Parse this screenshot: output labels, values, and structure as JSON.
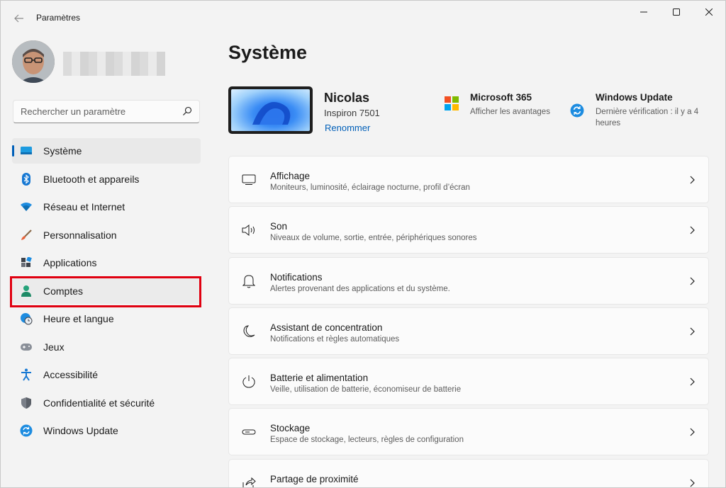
{
  "window": {
    "title": "Paramètres",
    "controls": {
      "minimize": "—",
      "maximize": "☐",
      "close": "✕"
    }
  },
  "sidebar": {
    "search": {
      "placeholder": "Rechercher un paramètre",
      "value": ""
    },
    "items": [
      {
        "label": "Système",
        "icon": "monitor-icon",
        "active": true
      },
      {
        "label": "Bluetooth et appareils",
        "icon": "bluetooth-icon"
      },
      {
        "label": "Réseau et Internet",
        "icon": "wifi-icon"
      },
      {
        "label": "Personnalisation",
        "icon": "paintbrush-icon"
      },
      {
        "label": "Applications",
        "icon": "apps-icon"
      },
      {
        "label": "Comptes",
        "icon": "person-icon",
        "highlighted": true
      },
      {
        "label": "Heure et langue",
        "icon": "globe-clock-icon"
      },
      {
        "label": "Jeux",
        "icon": "gamepad-icon"
      },
      {
        "label": "Accessibilité",
        "icon": "accessibility-icon"
      },
      {
        "label": "Confidentialité et sécurité",
        "icon": "shield-icon"
      },
      {
        "label": "Windows Update",
        "icon": "sync-icon"
      }
    ]
  },
  "main": {
    "page_title": "Système",
    "device": {
      "name": "Nicolas",
      "model": "Inspiron 7501",
      "rename_label": "Renommer"
    },
    "microsoft365": {
      "title": "Microsoft 365",
      "subtitle": "Afficher les avantages"
    },
    "windows_update": {
      "title": "Windows Update",
      "subtitle_line1": "Dernière vérification : il y a 4",
      "subtitle_line2": "heures"
    },
    "cards": [
      {
        "title": "Affichage",
        "description": "Moniteurs, luminosité, éclairage nocturne, profil d’écran",
        "icon": "display-icon"
      },
      {
        "title": "Son",
        "description": "Niveaux de volume, sortie, entrée, périphériques sonores",
        "icon": "speaker-icon"
      },
      {
        "title": "Notifications",
        "description": "Alertes provenant des applications et du système.",
        "icon": "bell-icon"
      },
      {
        "title": "Assistant de concentration",
        "description": "Notifications et règles automatiques",
        "icon": "moon-icon"
      },
      {
        "title": "Batterie et alimentation",
        "description": "Veille, utilisation de batterie, économiseur de batterie",
        "icon": "power-icon"
      },
      {
        "title": "Stockage",
        "description": "Espace de stockage, lecteurs, règles de configuration",
        "icon": "storage-icon"
      },
      {
        "title": "Partage de proximité",
        "description": "",
        "icon": "share-icon"
      }
    ]
  },
  "colors": {
    "accent": "#005fb8",
    "highlight_border": "#e00010",
    "window_bg": "#f3f3f3",
    "card_bg": "#fbfbfb"
  }
}
